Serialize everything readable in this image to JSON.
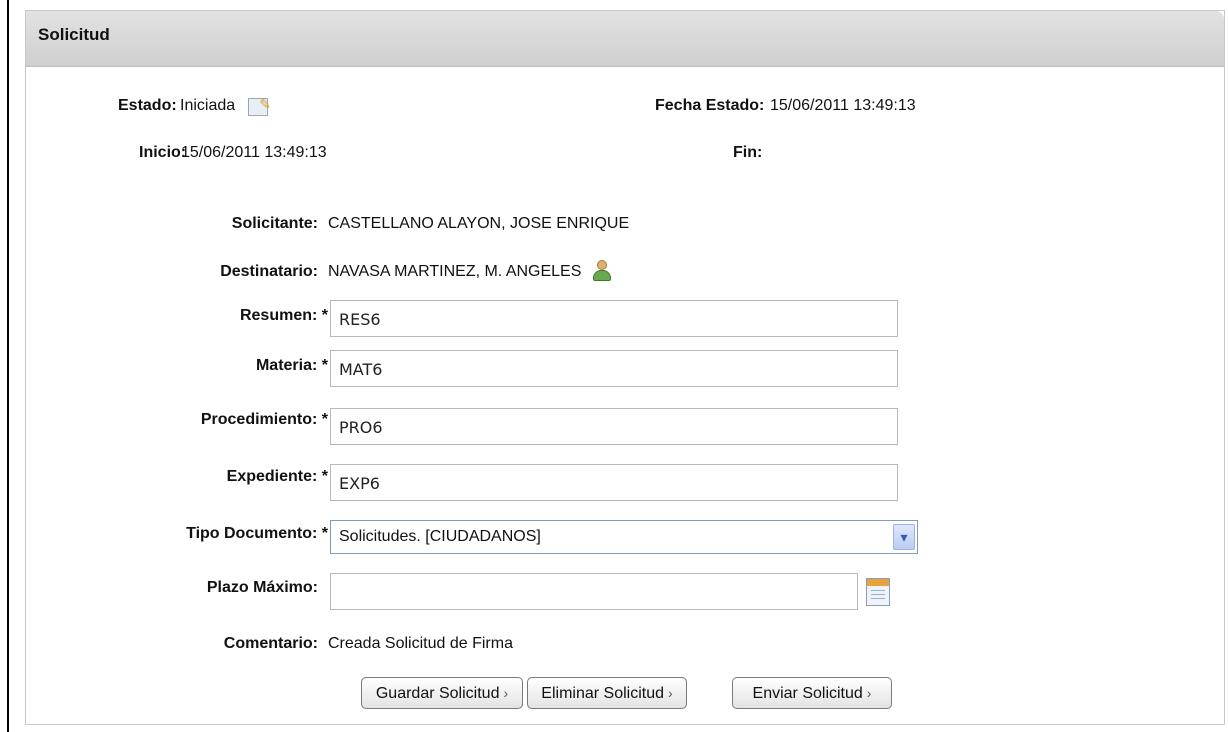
{
  "panel": {
    "title": "Solicitud"
  },
  "status": {
    "estado_label": "Estado:",
    "estado_value": "Iniciada",
    "fecha_estado_label": "Fecha Estado:",
    "fecha_estado_value": "15/06/2011 13:49:13",
    "inicio_label": "Inicio:",
    "inicio_value": "15/06/2011 13:49:13",
    "fin_label": "Fin:",
    "fin_value": ""
  },
  "form": {
    "solicitante_label": "Solicitante:",
    "solicitante_value": "CASTELLANO ALAYON, JOSE ENRIQUE",
    "destinatario_label": "Destinatario:",
    "destinatario_value": "NAVASA MARTINEZ, M. ANGELES",
    "resumen_label": "Resumen: *",
    "resumen_value": "RES6",
    "materia_label": "Materia: *",
    "materia_value": "MAT6",
    "procedimiento_label": "Procedimiento: *",
    "procedimiento_value": "PRO6",
    "expediente_label": "Expediente: *",
    "expediente_value": "EXP6",
    "tipo_documento_label": "Tipo Documento: *",
    "tipo_documento_value": "Solicitudes. [CIUDADANOS]",
    "plazo_maximo_label": "Plazo Máximo:",
    "plazo_maximo_value": "",
    "comentario_label": "Comentario:",
    "comentario_value": "Creada Solicitud de Firma"
  },
  "buttons": {
    "guardar": "Guardar Solicitud",
    "eliminar": "Eliminar Solicitud",
    "enviar": "Enviar Solicitud",
    "arrow": "›"
  },
  "icons": [
    "edit-icon",
    "user-icon",
    "calendar-icon",
    "chevron-down-icon"
  ]
}
